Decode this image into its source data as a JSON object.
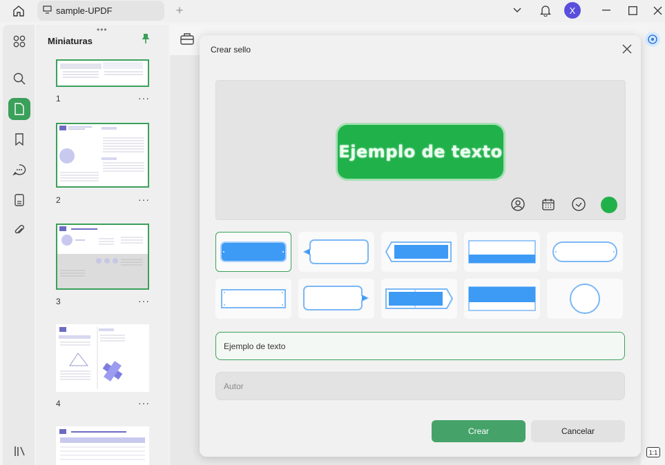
{
  "titlebar": {
    "tab_title": "sample-UPDF",
    "avatar_initial": "X"
  },
  "thumbnails": {
    "title": "Miniaturas",
    "handle": "•••",
    "pages": [
      {
        "num": "1",
        "more": "···"
      },
      {
        "num": "2",
        "more": "···"
      },
      {
        "num": "3",
        "more": "···"
      },
      {
        "num": "4",
        "more": "···"
      }
    ]
  },
  "modal": {
    "title": "Crear sello",
    "stamp_preview_text": "Ejemplo de texto",
    "text_field_value": "Ejemplo de texto",
    "author_placeholder": "Autor",
    "create_label": "Crear",
    "cancel_label": "Cancelar",
    "stamp_color": "#21b14b"
  },
  "statusbar": {
    "zoom_badge": "1:1"
  },
  "colors": {
    "accent": "#3aa05a",
    "stamp_blue": "#3d9af5"
  }
}
